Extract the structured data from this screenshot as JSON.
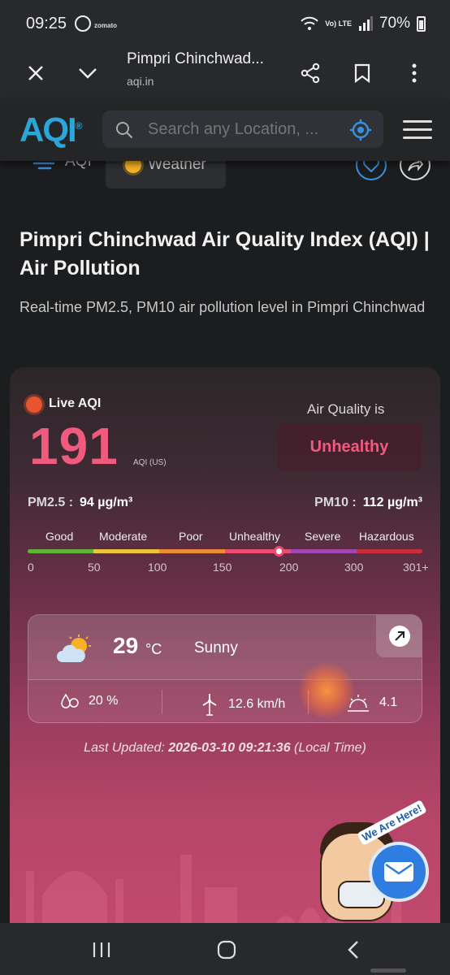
{
  "status_bar": {
    "time": "09:25",
    "notification_text": "zomato",
    "network": "Vo) LTE",
    "battery": "70%"
  },
  "browser": {
    "page_title": "Pimpri Chinchwad...",
    "url": "aqi.in",
    "icons": [
      "close-icon",
      "chevron-down-icon",
      "share-icon",
      "bookmark-icon",
      "more-vertical-icon"
    ]
  },
  "site_header": {
    "logo": "AQI",
    "logo_mark": "®",
    "search_placeholder": "Search any Location, ..."
  },
  "tabs": {
    "aqi": "AQI",
    "weather": "Weather"
  },
  "page": {
    "title": "Pimpri Chinchwad Air Quality Index (AQI) | Air Pollution",
    "subtitle": "Real-time PM2.5, PM10 air pollution level in Pimpri Chinchwad"
  },
  "aqi_card": {
    "live_label": "Live AQI",
    "aqi_value": "191",
    "aqi_unit": "AQI (US)",
    "air_quality_label": "Air Quality is",
    "status": "Unhealthy",
    "status_color": "#f05a7e",
    "pm25_label": "PM2.5 :",
    "pm25_value": "94 µg/m³",
    "pm10_label": "PM10 :",
    "pm10_value": "112 µg/m³",
    "scale_categories": [
      "Good",
      "Moderate",
      "Poor",
      "Unhealthy",
      "Severe",
      "Hazardous"
    ],
    "scale_colors": [
      "#61b33b",
      "#edc33a",
      "#ec8d35",
      "#ea4d6f",
      "#a447b5",
      "#c92f3b"
    ],
    "scale_ticks": [
      "0",
      "50",
      "100",
      "150",
      "200",
      "300",
      "301+"
    ],
    "marker_value": 191
  },
  "weather": {
    "temperature": "29",
    "temperature_unit": "°C",
    "condition": "Sunny",
    "humidity": "20 %",
    "wind": "12.6 km/h",
    "uv_index": "4.1"
  },
  "last_updated": {
    "prefix": "Last Updated:",
    "datetime": "2026-03-10 09:21:36",
    "suffix": "(Local Time)"
  },
  "chat_widget": {
    "banner": "We Are Here!"
  }
}
